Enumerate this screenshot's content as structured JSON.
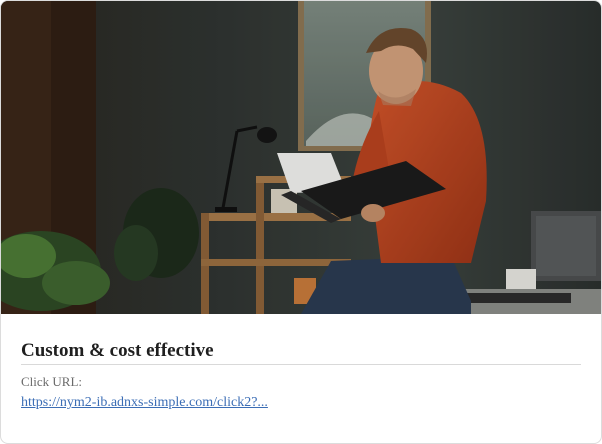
{
  "card": {
    "image_alt": "",
    "title": "Custom & cost effective",
    "click_url_label": "Click URL:",
    "click_url": "https://nym2-ib.adnxs-simple.com/click2?..."
  },
  "colors": {
    "link": "#3b6db5",
    "title": "#1f1f1f",
    "label": "#6a6a6a"
  }
}
